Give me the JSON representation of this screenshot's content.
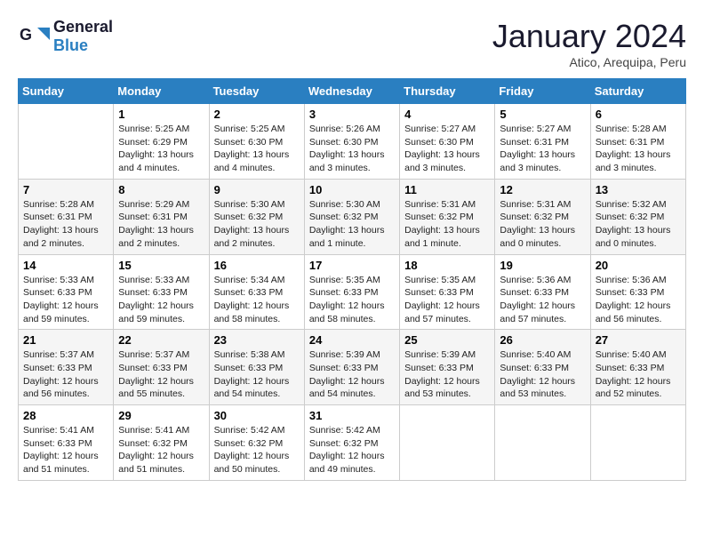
{
  "logo": {
    "line1": "General",
    "line2": "Blue"
  },
  "title": "January 2024",
  "location": "Atico, Arequipa, Peru",
  "headers": [
    "Sunday",
    "Monday",
    "Tuesday",
    "Wednesday",
    "Thursday",
    "Friday",
    "Saturday"
  ],
  "weeks": [
    [
      {
        "day": "",
        "sunrise": "",
        "sunset": "",
        "daylight": ""
      },
      {
        "day": "1",
        "sunrise": "Sunrise: 5:25 AM",
        "sunset": "Sunset: 6:29 PM",
        "daylight": "Daylight: 13 hours and 4 minutes."
      },
      {
        "day": "2",
        "sunrise": "Sunrise: 5:25 AM",
        "sunset": "Sunset: 6:30 PM",
        "daylight": "Daylight: 13 hours and 4 minutes."
      },
      {
        "day": "3",
        "sunrise": "Sunrise: 5:26 AM",
        "sunset": "Sunset: 6:30 PM",
        "daylight": "Daylight: 13 hours and 3 minutes."
      },
      {
        "day": "4",
        "sunrise": "Sunrise: 5:27 AM",
        "sunset": "Sunset: 6:30 PM",
        "daylight": "Daylight: 13 hours and 3 minutes."
      },
      {
        "day": "5",
        "sunrise": "Sunrise: 5:27 AM",
        "sunset": "Sunset: 6:31 PM",
        "daylight": "Daylight: 13 hours and 3 minutes."
      },
      {
        "day": "6",
        "sunrise": "Sunrise: 5:28 AM",
        "sunset": "Sunset: 6:31 PM",
        "daylight": "Daylight: 13 hours and 3 minutes."
      }
    ],
    [
      {
        "day": "7",
        "sunrise": "Sunrise: 5:28 AM",
        "sunset": "Sunset: 6:31 PM",
        "daylight": "Daylight: 13 hours and 2 minutes."
      },
      {
        "day": "8",
        "sunrise": "Sunrise: 5:29 AM",
        "sunset": "Sunset: 6:31 PM",
        "daylight": "Daylight: 13 hours and 2 minutes."
      },
      {
        "day": "9",
        "sunrise": "Sunrise: 5:30 AM",
        "sunset": "Sunset: 6:32 PM",
        "daylight": "Daylight: 13 hours and 2 minutes."
      },
      {
        "day": "10",
        "sunrise": "Sunrise: 5:30 AM",
        "sunset": "Sunset: 6:32 PM",
        "daylight": "Daylight: 13 hours and 1 minute."
      },
      {
        "day": "11",
        "sunrise": "Sunrise: 5:31 AM",
        "sunset": "Sunset: 6:32 PM",
        "daylight": "Daylight: 13 hours and 1 minute."
      },
      {
        "day": "12",
        "sunrise": "Sunrise: 5:31 AM",
        "sunset": "Sunset: 6:32 PM",
        "daylight": "Daylight: 13 hours and 0 minutes."
      },
      {
        "day": "13",
        "sunrise": "Sunrise: 5:32 AM",
        "sunset": "Sunset: 6:32 PM",
        "daylight": "Daylight: 13 hours and 0 minutes."
      }
    ],
    [
      {
        "day": "14",
        "sunrise": "Sunrise: 5:33 AM",
        "sunset": "Sunset: 6:33 PM",
        "daylight": "Daylight: 12 hours and 59 minutes."
      },
      {
        "day": "15",
        "sunrise": "Sunrise: 5:33 AM",
        "sunset": "Sunset: 6:33 PM",
        "daylight": "Daylight: 12 hours and 59 minutes."
      },
      {
        "day": "16",
        "sunrise": "Sunrise: 5:34 AM",
        "sunset": "Sunset: 6:33 PM",
        "daylight": "Daylight: 12 hours and 58 minutes."
      },
      {
        "day": "17",
        "sunrise": "Sunrise: 5:35 AM",
        "sunset": "Sunset: 6:33 PM",
        "daylight": "Daylight: 12 hours and 58 minutes."
      },
      {
        "day": "18",
        "sunrise": "Sunrise: 5:35 AM",
        "sunset": "Sunset: 6:33 PM",
        "daylight": "Daylight: 12 hours and 57 minutes."
      },
      {
        "day": "19",
        "sunrise": "Sunrise: 5:36 AM",
        "sunset": "Sunset: 6:33 PM",
        "daylight": "Daylight: 12 hours and 57 minutes."
      },
      {
        "day": "20",
        "sunrise": "Sunrise: 5:36 AM",
        "sunset": "Sunset: 6:33 PM",
        "daylight": "Daylight: 12 hours and 56 minutes."
      }
    ],
    [
      {
        "day": "21",
        "sunrise": "Sunrise: 5:37 AM",
        "sunset": "Sunset: 6:33 PM",
        "daylight": "Daylight: 12 hours and 56 minutes."
      },
      {
        "day": "22",
        "sunrise": "Sunrise: 5:37 AM",
        "sunset": "Sunset: 6:33 PM",
        "daylight": "Daylight: 12 hours and 55 minutes."
      },
      {
        "day": "23",
        "sunrise": "Sunrise: 5:38 AM",
        "sunset": "Sunset: 6:33 PM",
        "daylight": "Daylight: 12 hours and 54 minutes."
      },
      {
        "day": "24",
        "sunrise": "Sunrise: 5:39 AM",
        "sunset": "Sunset: 6:33 PM",
        "daylight": "Daylight: 12 hours and 54 minutes."
      },
      {
        "day": "25",
        "sunrise": "Sunrise: 5:39 AM",
        "sunset": "Sunset: 6:33 PM",
        "daylight": "Daylight: 12 hours and 53 minutes."
      },
      {
        "day": "26",
        "sunrise": "Sunrise: 5:40 AM",
        "sunset": "Sunset: 6:33 PM",
        "daylight": "Daylight: 12 hours and 53 minutes."
      },
      {
        "day": "27",
        "sunrise": "Sunrise: 5:40 AM",
        "sunset": "Sunset: 6:33 PM",
        "daylight": "Daylight: 12 hours and 52 minutes."
      }
    ],
    [
      {
        "day": "28",
        "sunrise": "Sunrise: 5:41 AM",
        "sunset": "Sunset: 6:33 PM",
        "daylight": "Daylight: 12 hours and 51 minutes."
      },
      {
        "day": "29",
        "sunrise": "Sunrise: 5:41 AM",
        "sunset": "Sunset: 6:32 PM",
        "daylight": "Daylight: 12 hours and 51 minutes."
      },
      {
        "day": "30",
        "sunrise": "Sunrise: 5:42 AM",
        "sunset": "Sunset: 6:32 PM",
        "daylight": "Daylight: 12 hours and 50 minutes."
      },
      {
        "day": "31",
        "sunrise": "Sunrise: 5:42 AM",
        "sunset": "Sunset: 6:32 PM",
        "daylight": "Daylight: 12 hours and 49 minutes."
      },
      {
        "day": "",
        "sunrise": "",
        "sunset": "",
        "daylight": ""
      },
      {
        "day": "",
        "sunrise": "",
        "sunset": "",
        "daylight": ""
      },
      {
        "day": "",
        "sunrise": "",
        "sunset": "",
        "daylight": ""
      }
    ]
  ]
}
